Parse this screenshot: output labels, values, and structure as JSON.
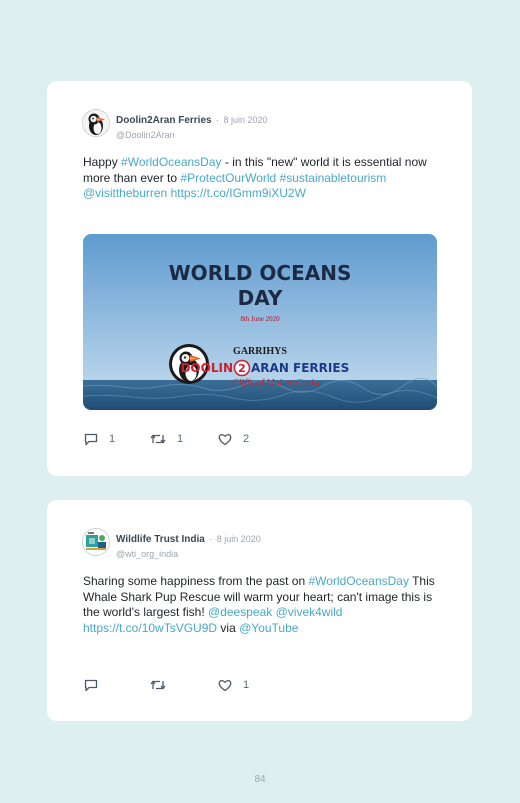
{
  "tweets": [
    {
      "author": "Doolin2Aran Ferries",
      "separator": "·",
      "date": "8 juin 2020",
      "handle": "@Doolin2Aran",
      "text": {
        "t1": "Happy ",
        "l1": "#WorldOceansDay",
        "t2": " - in this \"new\" world it is essential now more than ever to ",
        "l2": "#ProtectOurWorld",
        "t3": " ",
        "l3": "#sustainabletourism",
        "t4": " ",
        "l4": "@visittheburren",
        "t5": " ",
        "l5": "https://t.co/IGmm9iXU2W"
      },
      "media": {
        "title_line1": "WORLD OCEANS",
        "title_line2": "DAY",
        "date_line": "8th June 2020",
        "brand_top": "GARRIHYS",
        "brand_left": "DOOLIN",
        "brand_num": "2",
        "brand_right": "ARAN FERRIES",
        "brand_sub": "Cliffs of Moher Cruise"
      },
      "reply_count": "1",
      "retweet_count": "1",
      "like_count": "2",
      "colors": {
        "accent": "#4aa8c9",
        "sky": "#6fa8d8",
        "sea": "#2d5f8a"
      },
      "icons": [
        "puffin-avatar-icon",
        "reply-icon",
        "retweet-icon",
        "heart-icon"
      ]
    },
    {
      "author": "Wildlife Trust India",
      "separator": "·",
      "date": "8 juin 2020",
      "handle": "@wti_org_india",
      "text": {
        "t1": "Sharing some happiness from the past on ",
        "l1": "#WorldOceansDay",
        "t2": " This Whale Shark Pup Rescue will warm your heart; can't image this is the world's largest fish! ",
        "l2": "@deespeak",
        "t3": " ",
        "l3": "@vivek4wild",
        "t4": " ",
        "l4": "https://t.co/10wTsVGU9D",
        "t5": " via ",
        "l5": "@YouTube"
      },
      "like_count": "1",
      "icons": [
        "wti-logo-avatar-icon",
        "reply-icon",
        "retweet-icon",
        "heart-icon"
      ]
    }
  ],
  "page_number": "84"
}
